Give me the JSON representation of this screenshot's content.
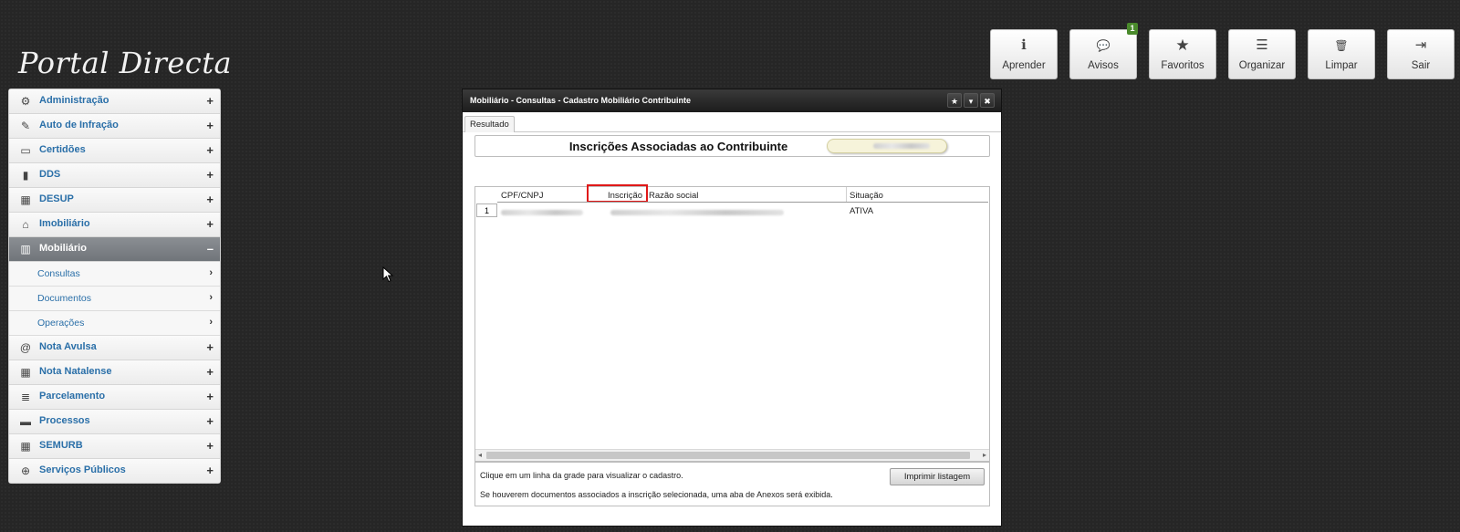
{
  "app": {
    "logo": "Portal Directa"
  },
  "toolbar": [
    {
      "label": "Aprender",
      "icon": "info-icon",
      "glyph": "ℹ"
    },
    {
      "label": "Avisos",
      "icon": "chat-icon",
      "glyph": "💬",
      "badge": "1"
    },
    {
      "label": "Favoritos",
      "icon": "star-icon",
      "glyph": "★"
    },
    {
      "label": "Organizar",
      "icon": "list-icon",
      "glyph": "☰"
    },
    {
      "label": "Limpar",
      "icon": "trash-icon",
      "glyph": "🗑"
    },
    {
      "label": "Sair",
      "icon": "exit-icon",
      "glyph": "⇥"
    }
  ],
  "sidebar": {
    "items": [
      {
        "label": "Administração",
        "icon": "gear-icon",
        "glyph": "⚙",
        "toggle": "+"
      },
      {
        "label": "Auto de Infração",
        "icon": "edit-icon",
        "glyph": "✎",
        "toggle": "+"
      },
      {
        "label": "Certidões",
        "icon": "inbox-icon",
        "glyph": "▭",
        "toggle": "+"
      },
      {
        "label": "DDS",
        "icon": "document-icon",
        "glyph": "▮",
        "toggle": "+"
      },
      {
        "label": "DESUP",
        "icon": "grid-icon",
        "glyph": "▦",
        "toggle": "+"
      },
      {
        "label": "Imobiliário",
        "icon": "home-icon",
        "glyph": "⌂",
        "toggle": "+"
      },
      {
        "label": "Mobiliário",
        "icon": "building-icon",
        "glyph": "▥",
        "toggle": "–"
      },
      {
        "label": "Nota Avulsa",
        "icon": "at-icon",
        "glyph": "@",
        "toggle": "+"
      },
      {
        "label": "Nota Natalense",
        "icon": "grid-icon",
        "glyph": "▦",
        "toggle": "+"
      },
      {
        "label": "Parcelamento",
        "icon": "stack-icon",
        "glyph": "≣",
        "toggle": "+"
      },
      {
        "label": "Processos",
        "icon": "folder-icon",
        "glyph": "▬",
        "toggle": "+"
      },
      {
        "label": "SEMURB",
        "icon": "grid-icon",
        "glyph": "▦",
        "toggle": "+"
      },
      {
        "label": "Serviços Públicos",
        "icon": "globe-icon",
        "glyph": "⊕",
        "toggle": "+"
      }
    ],
    "submenu": [
      {
        "label": "Consultas",
        "arrow": "›"
      },
      {
        "label": "Documentos",
        "arrow": "›"
      },
      {
        "label": "Operações",
        "arrow": "›"
      }
    ]
  },
  "window": {
    "title": "Mobiliário - Consultas - Cadastro Mobiliário Contribuinte",
    "controls": [
      "★",
      "▾",
      "✖"
    ],
    "tab": "Resultado",
    "heading": "Inscrições Associadas ao Contribuinte",
    "grid": {
      "columns": [
        "CPF/CNPJ",
        "Inscrição",
        "Razão social",
        "Situação"
      ],
      "rows": [
        {
          "num": "1",
          "situacao": "ATIVA"
        }
      ]
    },
    "footer": {
      "line1": "Clique em um linha da grade para visualizar o cadastro.",
      "line2": "Se houverem documentos associados a inscrição selecionada, uma aba de Anexos será exibida.",
      "print_button": "Imprimir listagem"
    }
  }
}
